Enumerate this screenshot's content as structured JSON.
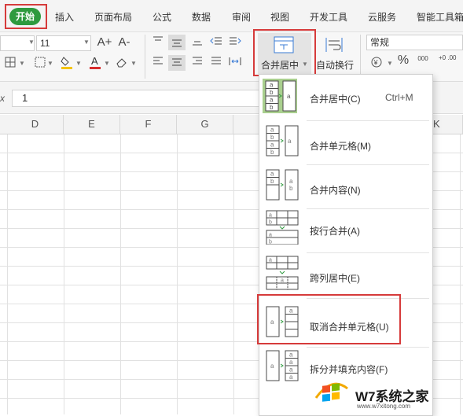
{
  "menubar": {
    "tabs": [
      "开始",
      "插入",
      "页面布局",
      "公式",
      "数据",
      "审阅",
      "视图",
      "开发工具",
      "云服务",
      "智能工具箱"
    ]
  },
  "ribbon": {
    "font_size": "11",
    "merge_label": "合并居中",
    "wrap_label": "自动换行",
    "number_format": "常规",
    "font_grow_icon": "A+",
    "font_shrink_icon": "A-",
    "percent_icon": "%",
    "thousands_icon": "000",
    "decimal_icon": "+0 .00"
  },
  "formula": {
    "name_marker": "x",
    "value": "1"
  },
  "columns": [
    "D",
    "E",
    "F",
    "G",
    "K"
  ],
  "dropdown": {
    "items": [
      {
        "label": "合并居中(C)",
        "shortcut": "Ctrl+M"
      },
      {
        "label": "合并单元格(M)",
        "shortcut": ""
      },
      {
        "label": "合并内容(N)",
        "shortcut": ""
      },
      {
        "label": "按行合并(A)",
        "shortcut": ""
      },
      {
        "label": "跨列居中(E)",
        "shortcut": ""
      },
      {
        "label": "取消合并单元格(U)",
        "shortcut": ""
      },
      {
        "label": "拆分并填充内容(F)",
        "shortcut": ""
      }
    ],
    "thumb_letters": [
      "a",
      "b"
    ]
  },
  "watermark": {
    "text": "W7系统之家",
    "url": "www.w7xitong.com"
  },
  "colors": {
    "accent_green": "#2e9a3e",
    "highlight_red": "#d63b3b",
    "thumb_highlight": "#a9cf8e"
  }
}
